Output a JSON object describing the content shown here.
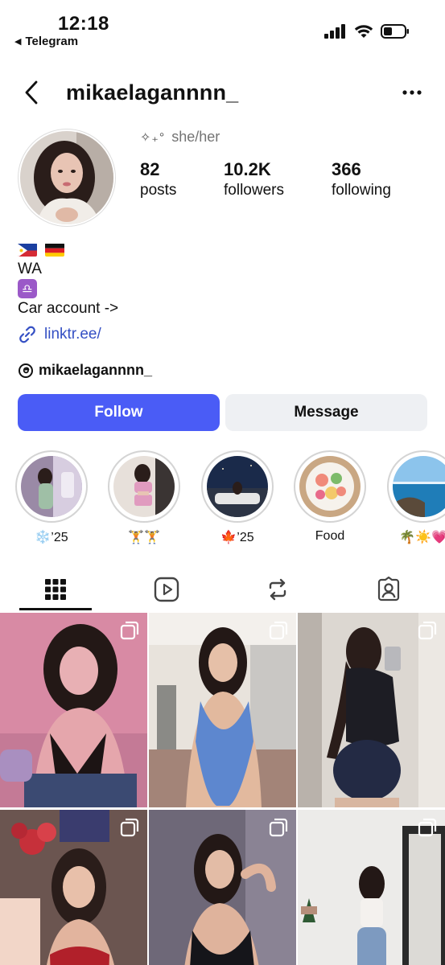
{
  "status_bar": {
    "time": "12:18",
    "back_app": "Telegram"
  },
  "header": {
    "username": "mikaelagannnn_"
  },
  "profile": {
    "pronoun_symbol": "✧₊°",
    "pronouns": "she/her",
    "stats": {
      "posts_count": "82",
      "posts_label": "posts",
      "followers_count": "10.2K",
      "followers_label": "followers",
      "following_count": "366",
      "following_label": "following"
    },
    "bio": {
      "location": "WA",
      "zodiac_emoji": "♎",
      "line": "Car account ->",
      "link": "linktr.ee/",
      "threads_handle": "mikaelagannnn_"
    }
  },
  "actions": {
    "follow_label": "Follow",
    "message_label": "Message"
  },
  "highlights": [
    {
      "label": "❄️’25"
    },
    {
      "label": "🏋🏋"
    },
    {
      "label": "🍁’25"
    },
    {
      "label": "Food"
    },
    {
      "label": "🌴☀️💗"
    }
  ],
  "tabs": [
    {
      "name": "grid-icon"
    },
    {
      "name": "reels-icon"
    },
    {
      "name": "reposts-icon"
    },
    {
      "name": "tagged-icon"
    }
  ],
  "colors": {
    "follow_button": "#4a5cf6",
    "message_button": "#eef0f3",
    "link": "#3550c4"
  }
}
